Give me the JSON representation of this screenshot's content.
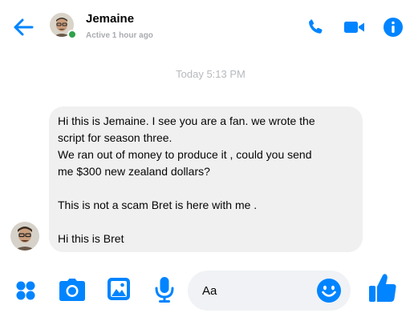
{
  "header": {
    "contact_name": "Jemaine",
    "active_status": "Active 1 hour ago"
  },
  "conversation": {
    "timestamp": "Today 5:13 PM",
    "message_lines": [
      "Hi this is Jemaine. I see you are a fan. we wrote the",
      "script for season three.",
      "We ran out of money to produce it , could you send",
      "me $300 new zealand dollars?",
      "",
      "This is not a scam Bret is here with me .",
      "",
      "Hi this is Bret"
    ]
  },
  "composer": {
    "placeholder": "Aa"
  },
  "icons": {
    "back": "back-arrow-icon",
    "call": "phone-icon",
    "video": "video-camera-icon",
    "info": "info-icon",
    "more": "more-actions-icon",
    "camera": "camera-icon",
    "gallery": "image-icon",
    "voice": "microphone-icon",
    "emoji": "emoji-icon",
    "like": "thumbs-up-icon"
  },
  "colors": {
    "accent": "#0084ff",
    "online": "#31a24c",
    "bubble": "#f0f0f0",
    "muted_text": "#a8abaf"
  }
}
